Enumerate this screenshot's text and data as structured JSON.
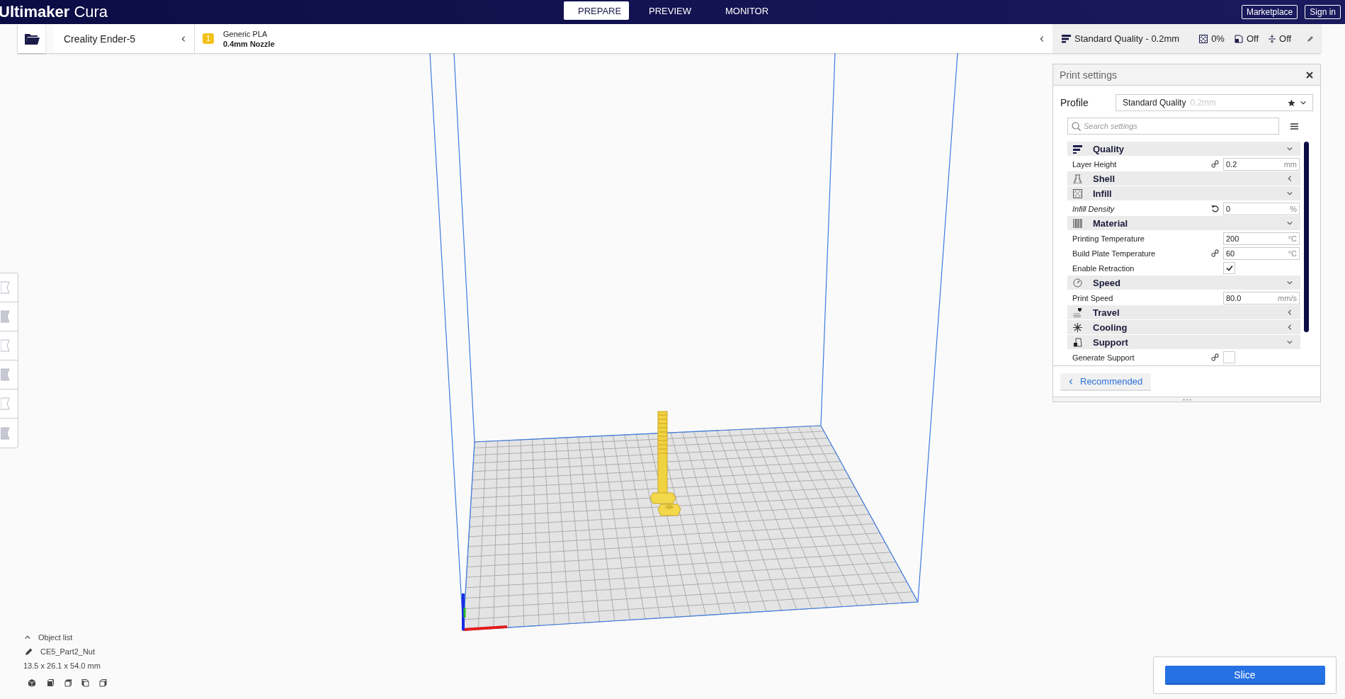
{
  "header": {
    "logo": "**Ultimaker** Cura",
    "tabs": [
      {
        "label": "PREPARE",
        "selected": true
      },
      {
        "label": "PREVIEW",
        "selected": false
      },
      {
        "label": "MONITOR",
        "selected": false
      }
    ],
    "buttons": [
      "Marketplace",
      "Sign in"
    ]
  },
  "printer_bar": {
    "printer": "Creality Ender-5",
    "material": {
      "badge": "1",
      "name": "Generic PLA",
      "nozzle": "0.4mm Nozzle"
    },
    "summary": {
      "profile": "Standard Quality - 0.2mm",
      "infill": "0%",
      "support": "Off",
      "adhesion": "Off"
    }
  },
  "print_settings": {
    "title": "Print settings",
    "profile_label": "Profile",
    "profile": "Standard Quality",
    "profile_detail": "0.2mm",
    "search_placeholder": "Search settings",
    "categories": [
      {
        "kind": "quality",
        "name": "Quality",
        "expanded": true,
        "settings": [
          {
            "kind": "number",
            "label": "Layer Height",
            "value": "0.2",
            "unit": "mm",
            "linked": true,
            "resettable": false,
            "modified": false
          }
        ]
      },
      {
        "kind": "shell",
        "name": "Shell",
        "expanded": false
      },
      {
        "kind": "infill",
        "name": "Infill",
        "expanded": true,
        "settings": [
          {
            "kind": "number",
            "label": "Infill Density",
            "value": "0",
            "unit": "%",
            "linked": false,
            "resettable": true,
            "modified": true
          }
        ]
      },
      {
        "kind": "material",
        "name": "Material",
        "expanded": true,
        "settings": [
          {
            "kind": "number",
            "label": "Printing Temperature",
            "value": "200",
            "unit": "°C",
            "linked": false,
            "resettable": false,
            "modified": false
          },
          {
            "kind": "number",
            "label": "Build Plate Temperature",
            "value": "60",
            "unit": "°C",
            "linked": true,
            "resettable": false,
            "modified": false
          },
          {
            "kind": "checkbox",
            "label": "Enable Retraction",
            "checked": true,
            "linked": false,
            "resettable": false,
            "modified": false
          }
        ]
      },
      {
        "kind": "speed",
        "name": "Speed",
        "expanded": true,
        "settings": [
          {
            "kind": "number",
            "label": "Print Speed",
            "value": "80.0",
            "unit": "mm/s",
            "linked": false,
            "resettable": false,
            "modified": false
          }
        ]
      },
      {
        "kind": "travel",
        "name": "Travel",
        "expanded": false
      },
      {
        "kind": "cooling",
        "name": "Cooling",
        "expanded": false
      },
      {
        "kind": "support",
        "name": "Support",
        "expanded": true,
        "settings": [
          {
            "kind": "checkbox",
            "label": "Generate Support",
            "checked": false,
            "linked": true,
            "resettable": false,
            "modified": false
          }
        ]
      }
    ],
    "recommended_button": "Recommended"
  },
  "object_list": {
    "toggle": "Object list",
    "expanded": false,
    "object": "CE5_Part2_Nut",
    "dimensions": "13.5 x 26.1 x 54.0 mm"
  },
  "slice_button": "Slice"
}
